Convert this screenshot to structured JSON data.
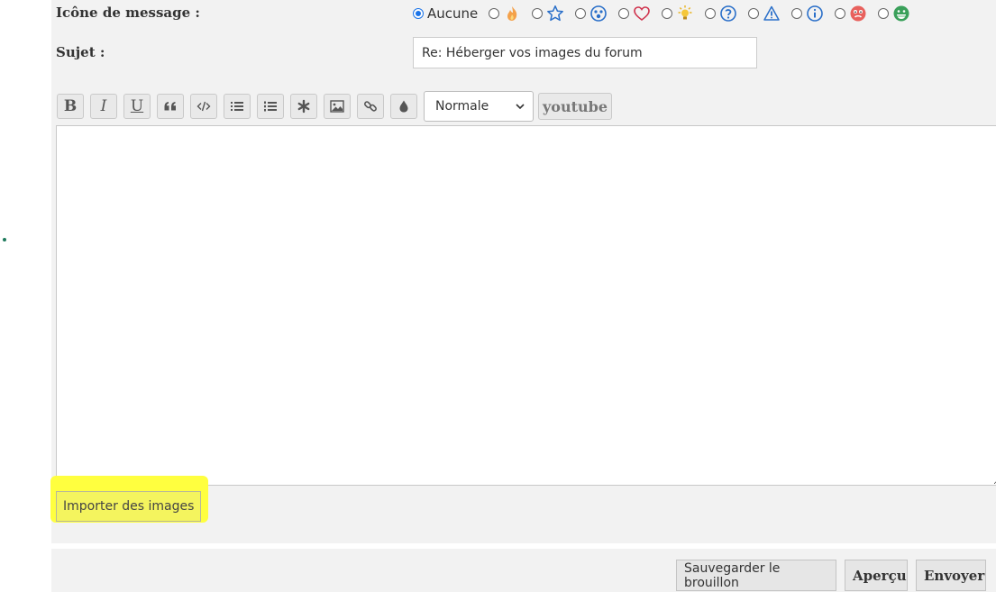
{
  "form": {
    "icon_label": "Icône de message :",
    "subject_label": "Sujet :",
    "subject_value": "Re: Héberger vos images du forum",
    "icon_options": [
      {
        "label": "Aucune",
        "icon": "none",
        "checked": true
      },
      {
        "label": "",
        "icon": "fire-icon",
        "checked": false
      },
      {
        "label": "",
        "icon": "star-icon",
        "checked": false
      },
      {
        "label": "",
        "icon": "surprised-face-icon",
        "checked": false
      },
      {
        "label": "",
        "icon": "heart-icon",
        "checked": false
      },
      {
        "label": "",
        "icon": "bulb-icon",
        "checked": false
      },
      {
        "label": "",
        "icon": "question-icon",
        "checked": false
      },
      {
        "label": "",
        "icon": "warning-icon",
        "checked": false
      },
      {
        "label": "",
        "icon": "info-icon",
        "checked": false
      },
      {
        "label": "",
        "icon": "sad-face-icon",
        "checked": false
      },
      {
        "label": "",
        "icon": "grin-face-icon",
        "checked": false
      }
    ]
  },
  "toolbar": {
    "bold": "B",
    "italic": "I",
    "underline": "U",
    "buttons": [
      "quote-icon",
      "code-icon",
      "bullet-list-icon",
      "numbered-list-icon",
      "asterisk-icon",
      "image-icon",
      "link-icon",
      "color-drop-icon"
    ],
    "font_size_selected": "Normale",
    "youtube": "youtube"
  },
  "editor": {
    "content": ""
  },
  "attachments": {
    "import_label": "Importer des images"
  },
  "actions": {
    "save_draft": "Sauvegarder le brouillon",
    "preview": "Aperçu",
    "submit": "Envoyer"
  },
  "colors": {
    "panel_bg": "#f2f2f2",
    "highlight": "#ffff3f",
    "radio_accent": "#1a73e8"
  }
}
